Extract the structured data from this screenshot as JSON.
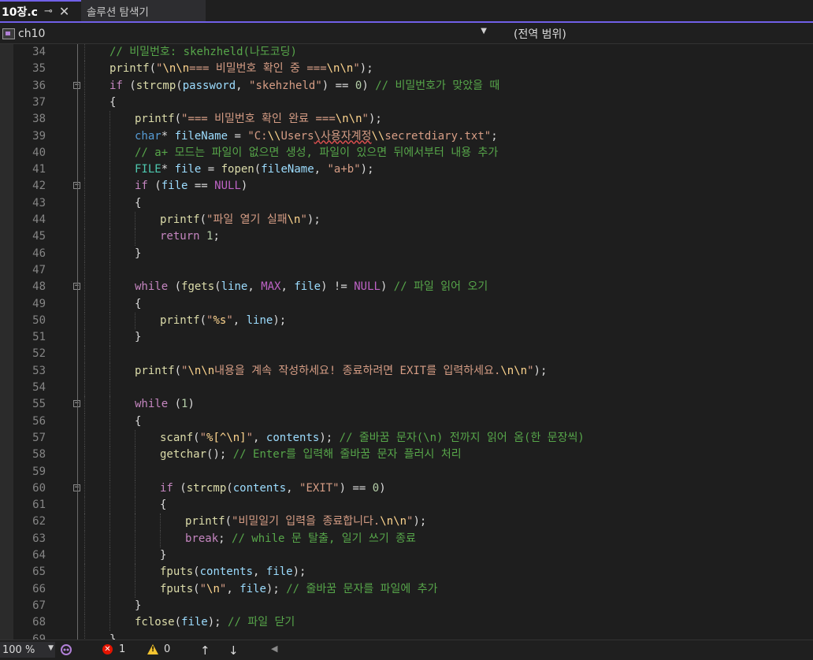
{
  "tabs": [
    {
      "label": "10장.c",
      "pin_icon": "pin-icon",
      "close_icon": "close-icon",
      "active": true
    },
    {
      "label": "솔루션 탐색기",
      "active": false
    }
  ],
  "navbar": {
    "project": "ch10",
    "scope": "(전역 범위)"
  },
  "lines": [
    {
      "n": "34",
      "indent": 1,
      "tokens": [
        [
          "c",
          "// 비밀번호: skehzheld(나도코딩)"
        ]
      ]
    },
    {
      "n": "35",
      "indent": 1,
      "tokens": [
        [
          "f",
          "printf"
        ],
        [
          "p",
          "("
        ],
        [
          "s",
          "\""
        ],
        [
          "e",
          "\\n\\n"
        ],
        [
          "s",
          "=== 비밀번호 확인 중 ==="
        ],
        [
          "e",
          "\\n\\n"
        ],
        [
          "s",
          "\""
        ],
        [
          "p",
          ");"
        ]
      ]
    },
    {
      "n": "36",
      "indent": 1,
      "fold": true,
      "tokens": [
        [
          "k",
          "if"
        ],
        [
          "p",
          " ("
        ],
        [
          "f",
          "strcmp"
        ],
        [
          "p",
          "("
        ],
        [
          "v",
          "password"
        ],
        [
          "p",
          ", "
        ],
        [
          "s",
          "\"skehzheld\""
        ],
        [
          "p",
          ") == "
        ],
        [
          "n",
          "0"
        ],
        [
          "p",
          ") "
        ],
        [
          "c",
          "// 비밀번호가 맞았을 때"
        ]
      ]
    },
    {
      "n": "37",
      "indent": 1,
      "tokens": [
        [
          "p",
          "{"
        ]
      ]
    },
    {
      "n": "38",
      "indent": 2,
      "tokens": [
        [
          "f",
          "printf"
        ],
        [
          "p",
          "("
        ],
        [
          "s",
          "\"=== 비밀번호 확인 완료 ==="
        ],
        [
          "e",
          "\\n\\n"
        ],
        [
          "s",
          "\""
        ],
        [
          "p",
          ");"
        ]
      ]
    },
    {
      "n": "39",
      "indent": 2,
      "tokens": [
        [
          "kb",
          "char"
        ],
        [
          "p",
          "* "
        ],
        [
          "v",
          "fileName"
        ],
        [
          "p",
          " = "
        ],
        [
          "s",
          "\"C:"
        ],
        [
          "e",
          "\\\\"
        ],
        [
          "s",
          "Users"
        ],
        [
          "sq",
          "\\사용자계정"
        ],
        [
          "e",
          "\\\\"
        ],
        [
          "s",
          "secretdiary.txt\""
        ],
        [
          "p",
          ";"
        ]
      ]
    },
    {
      "n": "40",
      "indent": 2,
      "tokens": [
        [
          "c",
          "// a+ 모드는 파일이 없으면 생성, 파일이 있으면 뒤에서부터 내용 추가"
        ]
      ]
    },
    {
      "n": "41",
      "indent": 2,
      "tokens": [
        [
          "t",
          "FILE"
        ],
        [
          "p",
          "* "
        ],
        [
          "v",
          "file"
        ],
        [
          "p",
          " = "
        ],
        [
          "f",
          "fopen"
        ],
        [
          "p",
          "("
        ],
        [
          "v",
          "fileName"
        ],
        [
          "p",
          ", "
        ],
        [
          "s",
          "\"a+b\""
        ],
        [
          "p",
          ");"
        ]
      ]
    },
    {
      "n": "42",
      "indent": 2,
      "fold": true,
      "tokens": [
        [
          "k",
          "if"
        ],
        [
          "p",
          " ("
        ],
        [
          "v",
          "file"
        ],
        [
          "p",
          " == "
        ],
        [
          "m",
          "NULL"
        ],
        [
          "p",
          ")"
        ]
      ]
    },
    {
      "n": "43",
      "indent": 2,
      "tokens": [
        [
          "p",
          "{"
        ]
      ]
    },
    {
      "n": "44",
      "indent": 3,
      "tokens": [
        [
          "f",
          "printf"
        ],
        [
          "p",
          "("
        ],
        [
          "s",
          "\"파일 열기 실패"
        ],
        [
          "e",
          "\\n"
        ],
        [
          "s",
          "\""
        ],
        [
          "p",
          ");"
        ]
      ]
    },
    {
      "n": "45",
      "indent": 3,
      "tokens": [
        [
          "k",
          "return"
        ],
        [
          "p",
          " "
        ],
        [
          "n",
          "1"
        ],
        [
          "p",
          ";"
        ]
      ]
    },
    {
      "n": "46",
      "indent": 2,
      "tokens": [
        [
          "p",
          "}"
        ]
      ]
    },
    {
      "n": "47",
      "indent": 2,
      "tokens": []
    },
    {
      "n": "48",
      "indent": 2,
      "fold": true,
      "tokens": [
        [
          "k",
          "while"
        ],
        [
          "p",
          " ("
        ],
        [
          "f",
          "fgets"
        ],
        [
          "p",
          "("
        ],
        [
          "v",
          "line"
        ],
        [
          "p",
          ", "
        ],
        [
          "m",
          "MAX"
        ],
        [
          "p",
          ", "
        ],
        [
          "v",
          "file"
        ],
        [
          "p",
          ") != "
        ],
        [
          "m",
          "NULL"
        ],
        [
          "p",
          ") "
        ],
        [
          "c",
          "// 파일 읽어 오기"
        ]
      ]
    },
    {
      "n": "49",
      "indent": 2,
      "tokens": [
        [
          "p",
          "{"
        ]
      ]
    },
    {
      "n": "50",
      "indent": 3,
      "tokens": [
        [
          "f",
          "printf"
        ],
        [
          "p",
          "("
        ],
        [
          "s",
          "\""
        ],
        [
          "e",
          "%s"
        ],
        [
          "s",
          "\""
        ],
        [
          "p",
          ", "
        ],
        [
          "v",
          "line"
        ],
        [
          "p",
          ");"
        ]
      ]
    },
    {
      "n": "51",
      "indent": 2,
      "tokens": [
        [
          "p",
          "}"
        ]
      ]
    },
    {
      "n": "52",
      "indent": 2,
      "tokens": []
    },
    {
      "n": "53",
      "indent": 2,
      "tokens": [
        [
          "f",
          "printf"
        ],
        [
          "p",
          "("
        ],
        [
          "s",
          "\""
        ],
        [
          "e",
          "\\n\\n"
        ],
        [
          "s",
          "내용을 계속 작성하세요! 종료하려면 EXIT를 입력하세요."
        ],
        [
          "e",
          "\\n\\n"
        ],
        [
          "s",
          "\""
        ],
        [
          "p",
          ");"
        ]
      ]
    },
    {
      "n": "54",
      "indent": 2,
      "tokens": []
    },
    {
      "n": "55",
      "indent": 2,
      "fold": true,
      "tokens": [
        [
          "k",
          "while"
        ],
        [
          "p",
          " ("
        ],
        [
          "n",
          "1"
        ],
        [
          "p",
          ")"
        ]
      ]
    },
    {
      "n": "56",
      "indent": 2,
      "tokens": [
        [
          "p",
          "{"
        ]
      ]
    },
    {
      "n": "57",
      "indent": 3,
      "tokens": [
        [
          "f",
          "scanf"
        ],
        [
          "p",
          "("
        ],
        [
          "s",
          "\""
        ],
        [
          "e",
          "%[^\\n]"
        ],
        [
          "s",
          "\""
        ],
        [
          "p",
          ", "
        ],
        [
          "v",
          "contents"
        ],
        [
          "p",
          "); "
        ],
        [
          "c",
          "// 줄바꿈 문자(\\n) 전까지 읽어 옴(한 문장씩)"
        ]
      ]
    },
    {
      "n": "58",
      "indent": 3,
      "tokens": [
        [
          "f",
          "getchar"
        ],
        [
          "p",
          "(); "
        ],
        [
          "c",
          "// Enter를 입력해 줄바꿈 문자 플러시 처리"
        ]
      ]
    },
    {
      "n": "59",
      "indent": 3,
      "tokens": []
    },
    {
      "n": "60",
      "indent": 3,
      "fold": true,
      "tokens": [
        [
          "k",
          "if"
        ],
        [
          "p",
          " ("
        ],
        [
          "f",
          "strcmp"
        ],
        [
          "p",
          "("
        ],
        [
          "v",
          "contents"
        ],
        [
          "p",
          ", "
        ],
        [
          "s",
          "\"EXIT\""
        ],
        [
          "p",
          ") == "
        ],
        [
          "n",
          "0"
        ],
        [
          "p",
          ")"
        ]
      ]
    },
    {
      "n": "61",
      "indent": 3,
      "tokens": [
        [
          "p",
          "{"
        ]
      ]
    },
    {
      "n": "62",
      "indent": 4,
      "tokens": [
        [
          "f",
          "printf"
        ],
        [
          "p",
          "("
        ],
        [
          "s",
          "\"비밀일기 입력을 종료합니다."
        ],
        [
          "e",
          "\\n\\n"
        ],
        [
          "s",
          "\""
        ],
        [
          "p",
          ");"
        ]
      ]
    },
    {
      "n": "63",
      "indent": 4,
      "tokens": [
        [
          "k",
          "break"
        ],
        [
          "p",
          "; "
        ],
        [
          "c",
          "// while 문 탈출, 일기 쓰기 종료"
        ]
      ]
    },
    {
      "n": "64",
      "indent": 3,
      "tokens": [
        [
          "p",
          "}"
        ]
      ]
    },
    {
      "n": "65",
      "indent": 3,
      "tokens": [
        [
          "f",
          "fputs"
        ],
        [
          "p",
          "("
        ],
        [
          "v",
          "contents"
        ],
        [
          "p",
          ", "
        ],
        [
          "v",
          "file"
        ],
        [
          "p",
          ");"
        ]
      ]
    },
    {
      "n": "66",
      "indent": 3,
      "tokens": [
        [
          "f",
          "fputs"
        ],
        [
          "p",
          "("
        ],
        [
          "s",
          "\""
        ],
        [
          "e",
          "\\n"
        ],
        [
          "s",
          "\""
        ],
        [
          "p",
          ", "
        ],
        [
          "v",
          "file"
        ],
        [
          "p",
          "); "
        ],
        [
          "c",
          "// 줄바꿈 문자를 파일에 추가"
        ]
      ]
    },
    {
      "n": "67",
      "indent": 2,
      "tokens": [
        [
          "p",
          "}"
        ]
      ]
    },
    {
      "n": "68",
      "indent": 2,
      "tokens": [
        [
          "f",
          "fclose"
        ],
        [
          "p",
          "("
        ],
        [
          "v",
          "file"
        ],
        [
          "p",
          "); "
        ],
        [
          "c",
          "// 파일 닫기"
        ]
      ]
    },
    {
      "n": "69",
      "indent": 1,
      "tokens": [
        [
          "p",
          "}"
        ]
      ]
    }
  ],
  "statusbar": {
    "zoom": "100 %",
    "errors": "1",
    "warnings": "0",
    "icons": [
      "git-copilot-icon",
      "error-icon",
      "warning-icon",
      "arrow-up-icon",
      "arrow-down-icon",
      "scroll-left-icon"
    ]
  },
  "colors": {
    "accent": "#7160e8",
    "keyword": "#c586c0",
    "type_keyword": "#569cd6",
    "function": "#dcdcaa",
    "string": "#d69d85",
    "escape": "#ffd68f",
    "comment": "#57a64a",
    "number": "#b5cea8",
    "variable": "#9cdcfe",
    "macro": "#bd63c5"
  }
}
